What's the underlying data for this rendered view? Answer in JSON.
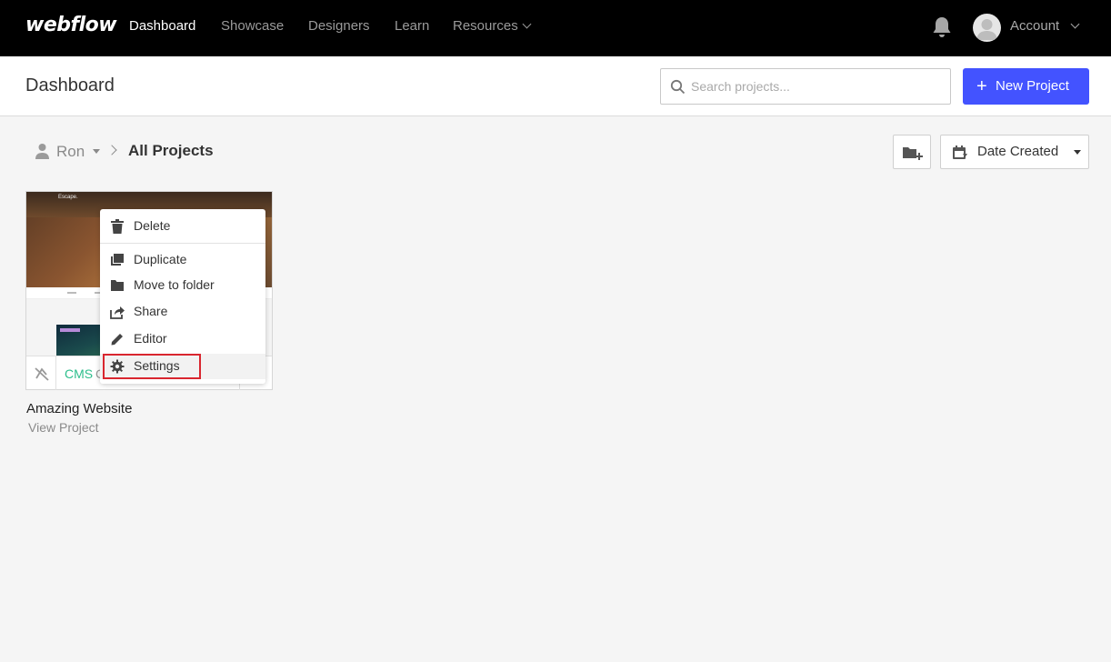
{
  "nav": {
    "logo": "webflow",
    "links": [
      {
        "label": "Dashboard",
        "active": true
      },
      {
        "label": "Showcase",
        "active": false
      },
      {
        "label": "Designers",
        "active": false
      },
      {
        "label": "Learn",
        "active": false
      },
      {
        "label": "Resources",
        "active": false,
        "dropdown": true
      }
    ],
    "account_label": "Account"
  },
  "header": {
    "title": "Dashboard",
    "search_placeholder": "Search projects...",
    "new_project_label": "New Project"
  },
  "breadcrumb": {
    "user": "Ron",
    "current": "All Projects"
  },
  "sort": {
    "selected": "Date Created"
  },
  "project": {
    "title": "Amazing Website",
    "link": "View Project",
    "badge": "CMS",
    "badge_extra": "C",
    "thumbnail_text": "Escape."
  },
  "context_menu": {
    "items": [
      {
        "label": "Delete",
        "icon": "trash-icon"
      },
      {
        "label": "Duplicate",
        "icon": "duplicate-icon"
      },
      {
        "label": "Move to folder",
        "icon": "folder-icon"
      },
      {
        "label": "Share",
        "icon": "share-icon"
      },
      {
        "label": "Editor",
        "icon": "pencil-icon"
      },
      {
        "label": "Settings",
        "icon": "gear-icon",
        "highlighted": true
      }
    ]
  },
  "colors": {
    "nav_bg": "#000000",
    "accent": "#4353ff",
    "cms_green": "#2dbe8c",
    "highlight_red": "#d9262f"
  }
}
